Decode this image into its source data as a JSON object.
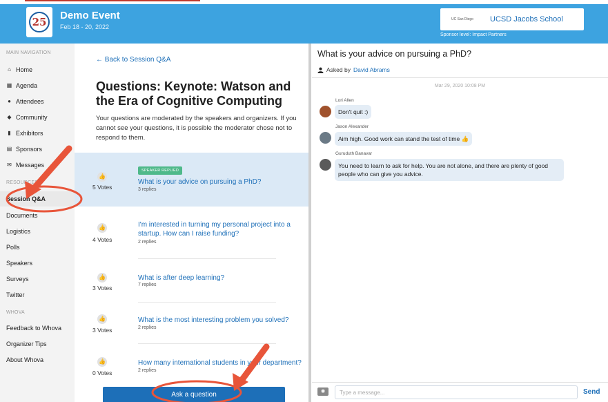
{
  "event": {
    "title": "Demo Event",
    "dates": "Feb 18 - 20, 2022",
    "logo_text": "25"
  },
  "sponsor": {
    "logo_text": "UC San Diego",
    "name": "UCSD Jacobs School",
    "level": "Sponsor level: Impact Partners"
  },
  "sidebar": {
    "main_label": "MAIN NAVIGATION",
    "main_items": [
      {
        "label": "Home",
        "icon": "home-icon"
      },
      {
        "label": "Agenda",
        "icon": "calendar-icon"
      },
      {
        "label": "Attendees",
        "icon": "people-icon"
      },
      {
        "label": "Community",
        "icon": "chat-icon"
      },
      {
        "label": "Exhibitors",
        "icon": "building-icon"
      },
      {
        "label": "Sponsors",
        "icon": "sponsor-icon"
      },
      {
        "label": "Messages",
        "icon": "envelope-icon"
      }
    ],
    "resources_label": "RESOURCES",
    "resource_items": [
      "Session Q&A",
      "Documents",
      "Logistics",
      "Polls",
      "Speakers",
      "Surveys",
      "Twitter"
    ],
    "whova_label": "WHOVA",
    "whova_items": [
      "Feedback to Whova",
      "Organizer Tips",
      "About Whova"
    ]
  },
  "qa": {
    "back_link": "← Back to Session Q&A",
    "title": "Questions: Keynote: Watson and the Era of Cognitive Computing",
    "description": "Your questions are moderated by the speakers and organizers. If you cannot see your questions, it is possible the moderator chose not to respond to them.",
    "questions": [
      {
        "votes": "5 Votes",
        "badge": "SPEAKER REPLIED",
        "text": "What is your advice on pursuing a PhD?",
        "replies": "3 replies"
      },
      {
        "votes": "4 Votes",
        "text": "I'm interested in turning my personal project into a startup. How can I raise funding?",
        "replies": "2 replies"
      },
      {
        "votes": "3 Votes",
        "text": "What is after deep learning?",
        "replies": "7 replies"
      },
      {
        "votes": "3 Votes",
        "text": "What is the most interesting problem you solved?",
        "replies": "2 replies"
      },
      {
        "votes": "0 Votes",
        "text": "How many international students in your department?",
        "replies": "2 replies"
      }
    ],
    "ask_button": "Ask a question"
  },
  "thread": {
    "title": "What is your advice on pursuing a PhD?",
    "asked_by_prefix": "Asked by",
    "asked_by_name": "David Abrams",
    "date": "Mar 29, 2020 10:08 PM",
    "messages": [
      {
        "author": "Lori Allen",
        "text": "Don't quit :)",
        "avatar_color": "#a0522d"
      },
      {
        "author": "Jason Alexander",
        "text": "Aim high. Good work can stand the test of time 👍",
        "avatar_color": "#6b7a86"
      },
      {
        "author": "Guruduth Banavar",
        "text": "You need to learn to ask for help. You are not alone, and there are plenty of good people who can give you advice.",
        "avatar_color": "#5a5a5a"
      }
    ],
    "input_placeholder": "Type a message...",
    "send_label": "Send"
  },
  "colors": {
    "header": "#3da3e0",
    "link": "#1d6fb8",
    "annotation": "#e8553a"
  }
}
